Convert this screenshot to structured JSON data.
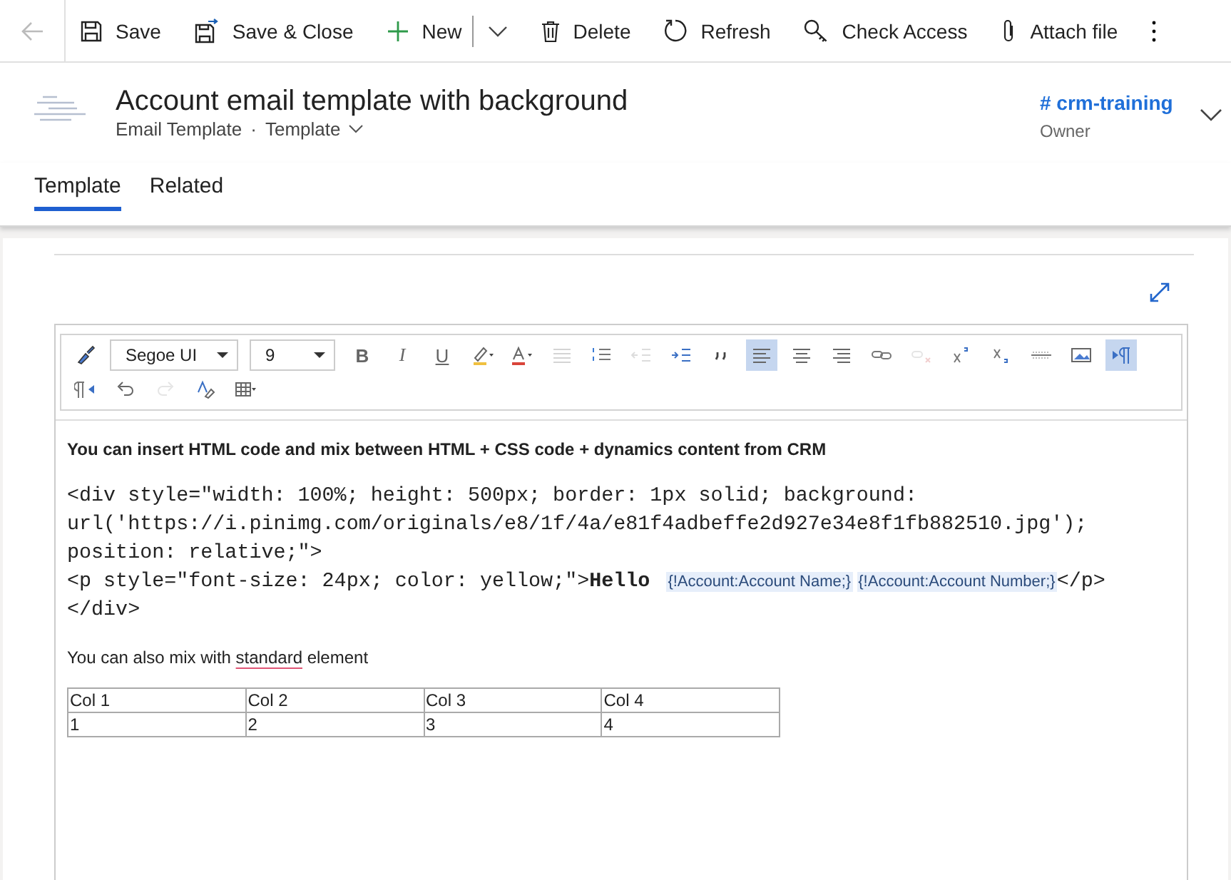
{
  "command_bar": {
    "back_disabled": true,
    "buttons": [
      {
        "kind": "save",
        "label": "Save"
      },
      {
        "kind": "save_close",
        "label": "Save & Close"
      },
      {
        "kind": "new",
        "label": "New"
      },
      {
        "kind": "split"
      },
      {
        "kind": "delete",
        "label": "Delete"
      },
      {
        "kind": "refresh",
        "label": "Refresh"
      },
      {
        "kind": "access",
        "label": "Check Access"
      },
      {
        "kind": "attach",
        "label": "Attach file"
      },
      {
        "kind": "more"
      }
    ]
  },
  "header": {
    "title": "Account email template with background",
    "entity": "Email Template",
    "separator": "·",
    "form": "Template",
    "owner": {
      "name": "# crm-training",
      "label": "Owner"
    }
  },
  "tabs": [
    {
      "label": "Template",
      "selected": true
    },
    {
      "label": "Related",
      "selected": false
    }
  ],
  "editor": {
    "font": "Segoe UI",
    "size": "9",
    "tools": [
      {
        "kind": "paint"
      },
      {
        "kind": "font"
      },
      {
        "kind": "size"
      },
      {
        "kind": "bold",
        "label": "B"
      },
      {
        "kind": "italic",
        "label": "I"
      },
      {
        "kind": "underline",
        "label": "U"
      },
      {
        "kind": "highlight"
      },
      {
        "kind": "fontcolor"
      },
      {
        "kind": "bullets",
        "disabled": true
      },
      {
        "kind": "numbers",
        "disabled": false
      },
      {
        "kind": "outdent",
        "disabled": true
      },
      {
        "kind": "indent",
        "disabled": false
      },
      {
        "kind": "quote",
        "disabled": false
      },
      {
        "kind": "align_left",
        "selected": true
      },
      {
        "kind": "align_center",
        "selected": false
      },
      {
        "kind": "align_right",
        "selected": false
      },
      {
        "kind": "link",
        "disabled": false
      },
      {
        "kind": "unlink",
        "disabled": true
      },
      {
        "kind": "sup"
      },
      {
        "kind": "sub"
      },
      {
        "kind": "strike"
      },
      {
        "kind": "image"
      },
      {
        "kind": "ltr",
        "selected": true
      },
      {
        "kind": "rtl",
        "selected": false
      },
      {
        "kind": "undo",
        "disabled": false
      },
      {
        "kind": "redo",
        "disabled": true
      },
      {
        "kind": "clear"
      },
      {
        "kind": "table"
      }
    ],
    "blocks": [
      {
        "kind": "bold",
        "lines": [
          [
            {
              "kind": "text",
              "text": "You can insert HTML code and mix between HTML + CSS code + dynamics content from CRM"
            }
          ]
        ]
      },
      {
        "kind": "code",
        "lines": [
          [
            {
              "kind": "text",
              "text": "<div style=\"width: 100%; height: 500px; border: 1px solid; background:"
            }
          ],
          [
            {
              "kind": "text",
              "text": "url('https://i.pinimg.com/originals/e8/1f/4a/e81f4adbeffe2d927e34e8f1fb882510.jpg');"
            }
          ],
          [
            {
              "kind": "text",
              "text": "position: relative;\">"
            }
          ],
          [
            {
              "kind": "text",
              "text": "<p style=\"font-size: 24px; color: yellow;\">"
            },
            {
              "kind": "strong",
              "text": "Hello "
            },
            {
              "kind": "field",
              "text": "{!Account:Account Name;}"
            },
            {
              "kind": "field",
              "text": "{!Account:Account Number;}"
            },
            {
              "kind": "text",
              "text": "</p>"
            }
          ],
          [
            {
              "kind": "text",
              "text": "</div>"
            }
          ]
        ]
      },
      {
        "kind": "plain",
        "lines": [
          [
            {
              "kind": "text",
              "text": "You can also mix with "
            },
            {
              "kind": "misspelled",
              "text": "standard"
            },
            {
              "kind": "text",
              "text": " element"
            }
          ]
        ]
      }
    ],
    "table": {
      "columns": [
        "Col 1",
        "Col 2",
        "Col 3",
        "Col 4"
      ],
      "rows": [
        [
          "1",
          "2",
          "3",
          "4"
        ]
      ]
    }
  }
}
